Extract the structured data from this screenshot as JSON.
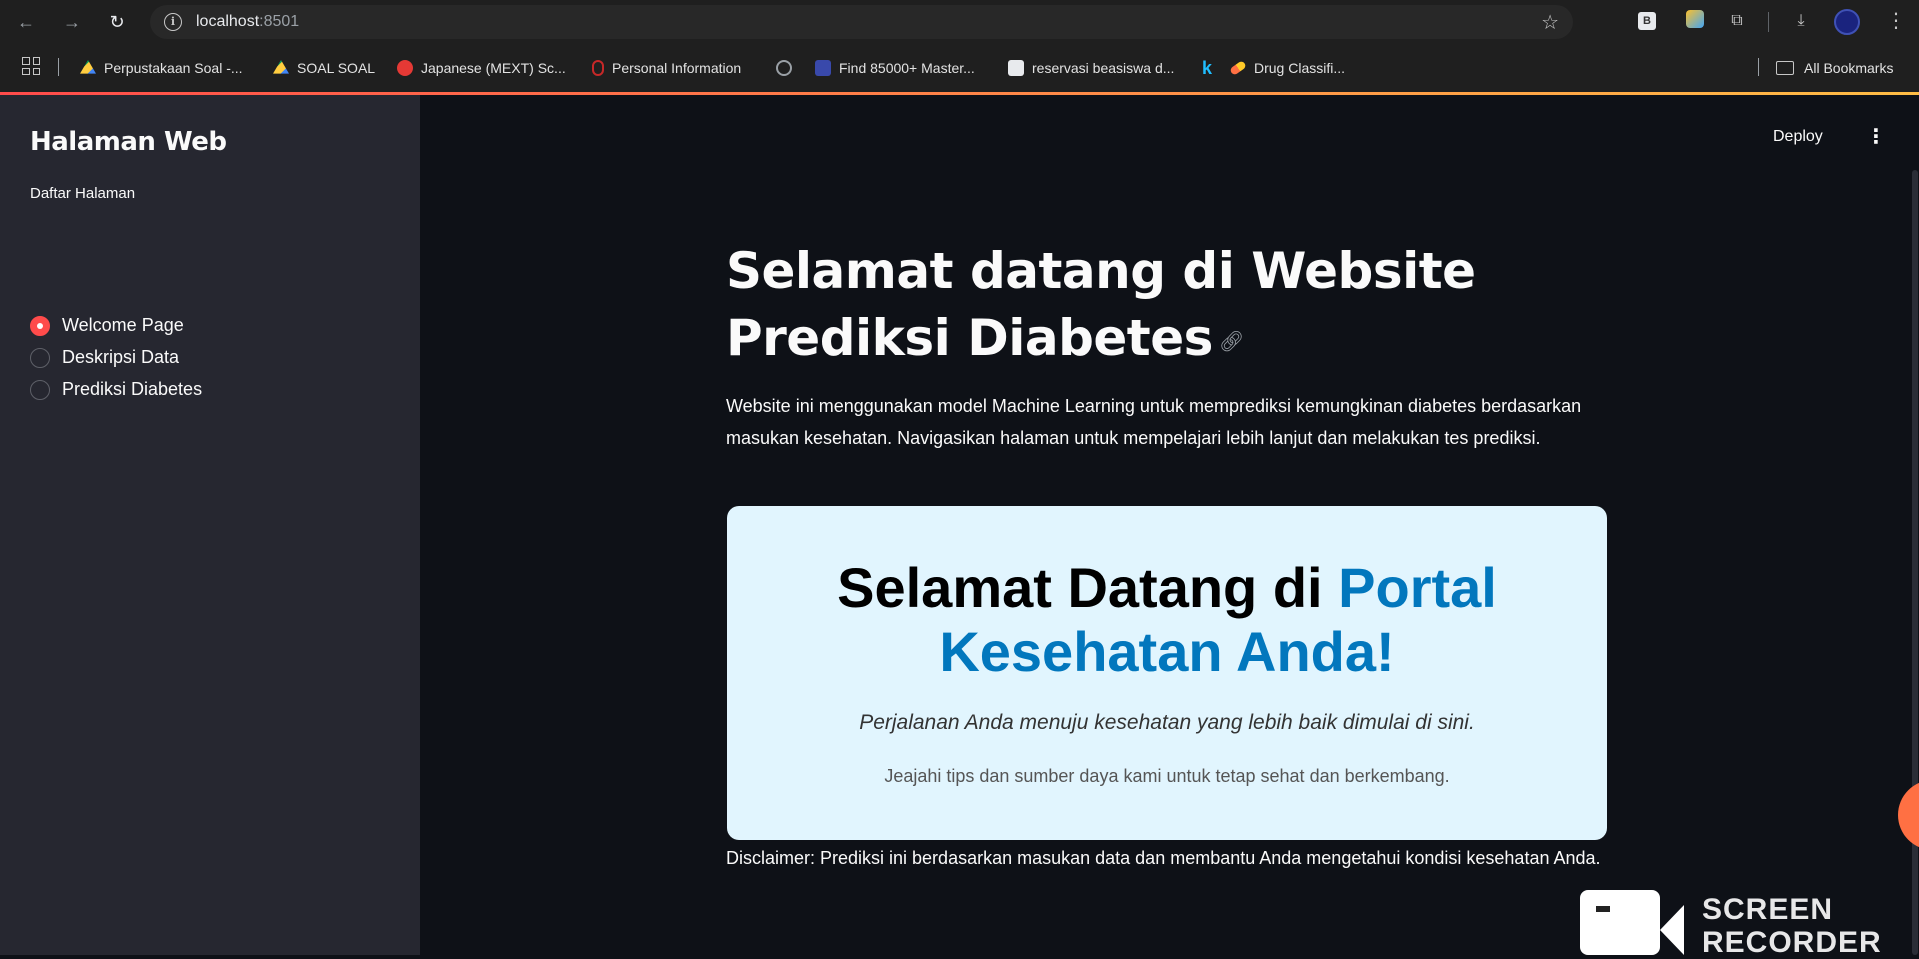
{
  "browser": {
    "url_host": "localhost",
    "url_port": ":8501",
    "bookmarks": [
      {
        "label": "Perpustakaan Soal -...",
        "icon": "google-drive-icon",
        "color": "#4285f4"
      },
      {
        "label": "SOAL SOAL",
        "icon": "google-drive-icon",
        "color": "#4285f4"
      },
      {
        "label": "Japanese (MEXT) Sc...",
        "icon": "red-logo-icon",
        "color": "#e53935"
      },
      {
        "label": "Personal Information",
        "icon": "mouse-icon",
        "color": "#c62828"
      },
      {
        "label": "",
        "icon": "globe-icon",
        "color": "#9aa0a6"
      },
      {
        "label": "Find 85000+ Master...",
        "icon": "university-icon",
        "color": "#3949ab"
      },
      {
        "label": "reservasi beasiswa d...",
        "icon": "g-logo-icon",
        "color": "#e8eaed"
      },
      {
        "label": "",
        "icon": "kaggle-icon",
        "color": "#20beff"
      },
      {
        "label": "Drug Classifi...",
        "icon": "pill-icon",
        "color": "#ff7043"
      }
    ],
    "all_bookmarks": "All Bookmarks"
  },
  "sidebar": {
    "title": "Halaman Web",
    "radio_label": "Daftar Halaman",
    "options": [
      {
        "label": "Welcome Page",
        "selected": true
      },
      {
        "label": "Deskripsi Data",
        "selected": false
      },
      {
        "label": "Prediksi Diabetes",
        "selected": false
      }
    ]
  },
  "header": {
    "deploy": "Deploy"
  },
  "main": {
    "title": "Selamat datang di Website Prediksi Diabetes",
    "intro": "Website ini menggunakan model Machine Learning untuk memprediksi kemungkinan diabetes berdasarkan masukan kesehatan. Navigasikan halaman untuk mempelajari lebih lanjut dan melakukan tes prediksi.",
    "card": {
      "title_plain": "Selamat Datang di ",
      "title_highlight": "Portal Kesehatan Anda!",
      "subtitle": "Perjalanan Anda menuju kesehatan yang lebih baik dimulai di sini.",
      "description": "Jeajahi tips dan sumber daya kami untuk tetap sehat dan berkembang.",
      "bg_color": "#e1f5fe",
      "highlight_color": "#0277bd"
    },
    "disclaimer": "Disclaimer: Prediksi ini berdasarkan masukan data dan membantu Anda mengetahui kondisi kesehatan Anda."
  },
  "overlay": {
    "watermark": "SCREEN RECORDER"
  }
}
